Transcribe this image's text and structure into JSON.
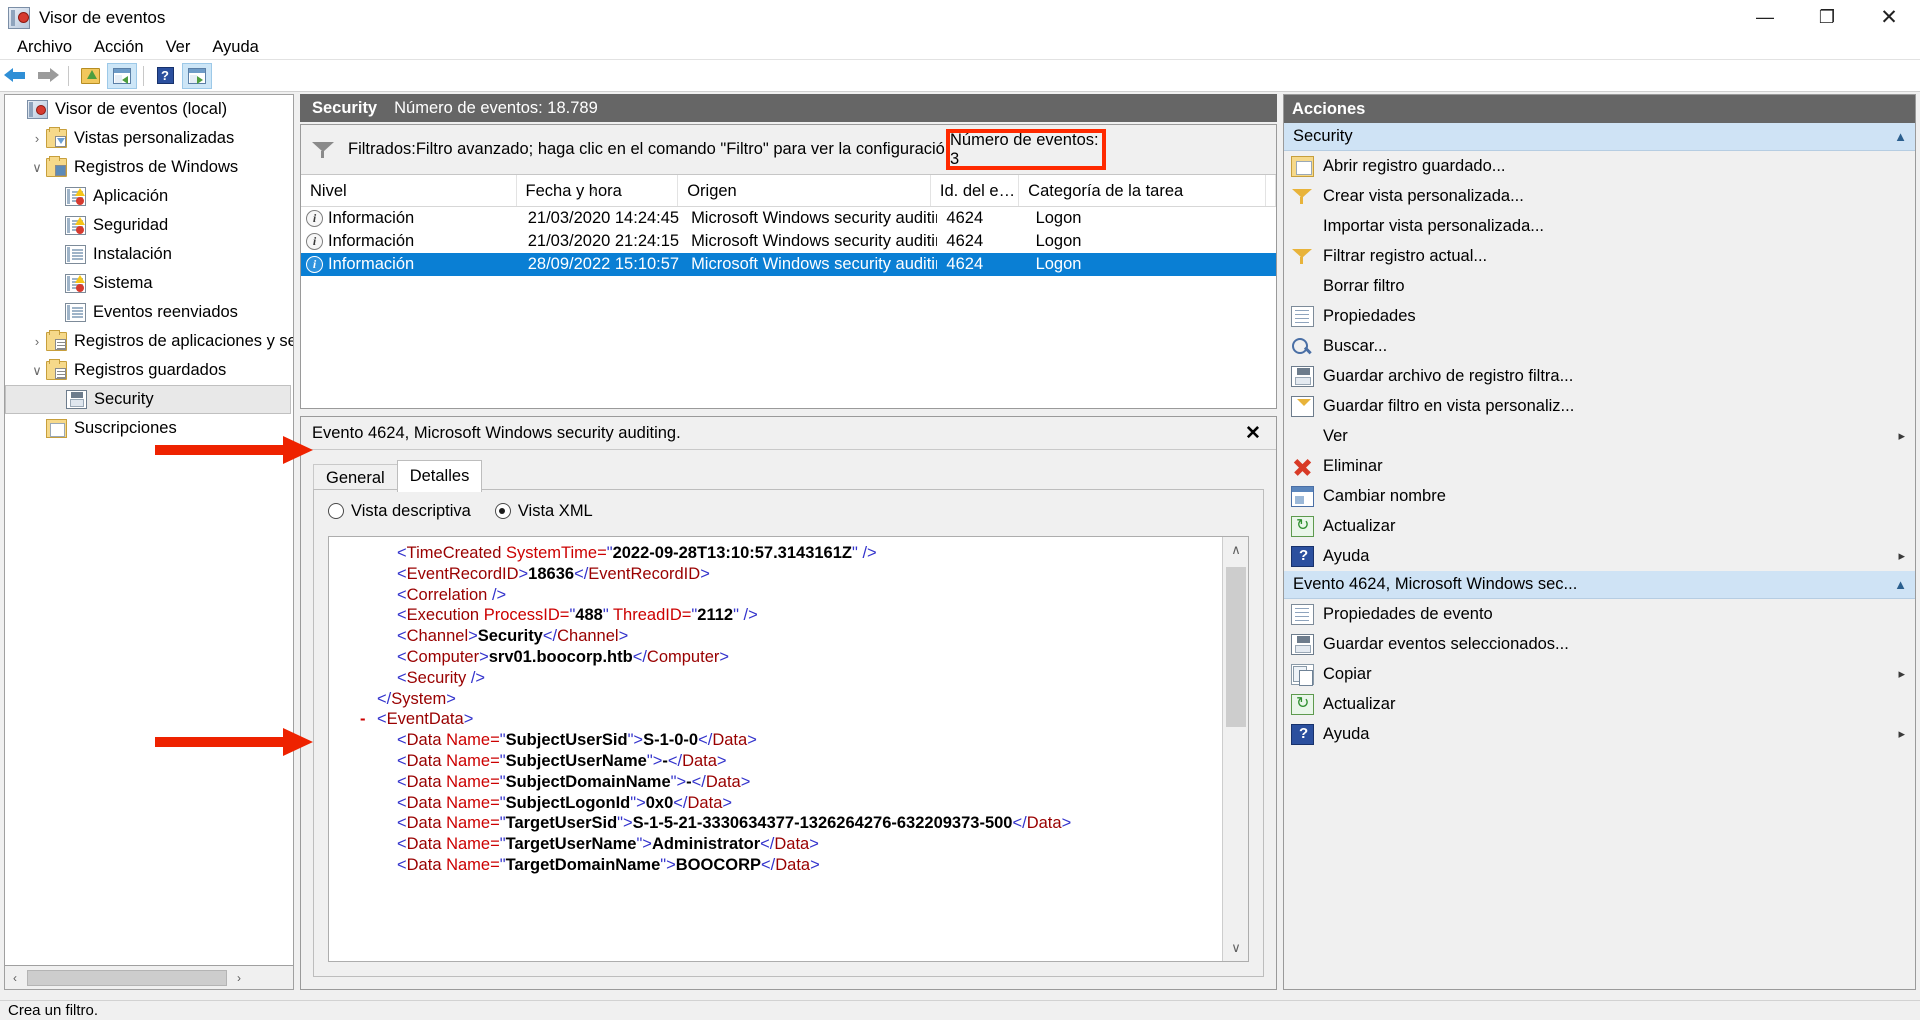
{
  "window": {
    "title": "Visor de eventos",
    "icon": "event-viewer-icon",
    "minimize": "—",
    "maximize": "❐",
    "close": "✕"
  },
  "menu": {
    "items": [
      "Archivo",
      "Acción",
      "Ver",
      "Ayuda"
    ]
  },
  "toolbar": {
    "back": "back-arrow-icon",
    "forward": "forward-arrow-icon",
    "open_folder": "open-folder-icon",
    "show_tree": "show-console-tree-icon",
    "help": "help-icon",
    "show_action_pane": "show-action-pane-icon"
  },
  "tree": {
    "items": [
      {
        "label": "Visor de eventos (local)",
        "indent": 0,
        "chevron": "",
        "icon": "event-viewer-icon"
      },
      {
        "label": "Vistas personalizadas",
        "indent": 1,
        "chevron": "›",
        "icon": "folder-filter-icon"
      },
      {
        "label": "Registros de Windows",
        "indent": 1,
        "chevron": "∨",
        "icon": "folder-windows-icon"
      },
      {
        "label": "Aplicación",
        "indent": 2,
        "chevron": "",
        "icon": "log-warning-icon"
      },
      {
        "label": "Seguridad",
        "indent": 2,
        "chevron": "",
        "icon": "log-warning-icon"
      },
      {
        "label": "Instalación",
        "indent": 2,
        "chevron": "",
        "icon": "log-icon"
      },
      {
        "label": "Sistema",
        "indent": 2,
        "chevron": "",
        "icon": "log-warning-icon"
      },
      {
        "label": "Eventos reenviados",
        "indent": 2,
        "chevron": "",
        "icon": "log-icon"
      },
      {
        "label": "Registros de aplicaciones y se",
        "indent": 1,
        "chevron": "›",
        "icon": "folder-apps-icon"
      },
      {
        "label": "Registros guardados",
        "indent": 1,
        "chevron": "∨",
        "icon": "folder-saved-icon"
      },
      {
        "label": "Security",
        "indent": 2,
        "chevron": "",
        "icon": "saved-log-icon",
        "selected": true
      },
      {
        "label": "Suscripciones",
        "indent": 1,
        "chevron": "",
        "icon": "subscriptions-icon"
      }
    ],
    "scroll_left": "‹",
    "scroll_right": "›"
  },
  "log_header": {
    "name": "Security",
    "count": "Número de eventos: 18.789"
  },
  "filter_bar": {
    "icon": "filter-funnel-icon",
    "text": "Filtrados:Filtro avanzado; haga clic en el comando \"Filtro\" para ver la configuración del filtro",
    "event_count": "Número de eventos: 3",
    "highlight_color": "#ff2a00"
  },
  "grid": {
    "columns": [
      "Nivel",
      "Fecha y hora",
      "Origen",
      "Id. del e…",
      "Categoría de la tarea"
    ],
    "sort_column_index": 1,
    "sort_mark": "˄",
    "rows": [
      {
        "level": "Información",
        "datetime": "21/03/2020 14:24:45",
        "source": "Microsoft Windows security auditing.",
        "event_id": "4624",
        "task": "Logon",
        "selected": false
      },
      {
        "level": "Información",
        "datetime": "21/03/2020 21:24:15",
        "source": "Microsoft Windows security auditing.",
        "event_id": "4624",
        "task": "Logon",
        "selected": false
      },
      {
        "level": "Información",
        "datetime": "28/09/2022 15:10:57",
        "source": "Microsoft Windows security auditing.",
        "event_id": "4624",
        "task": "Logon",
        "selected": true
      }
    ],
    "selection_color": "#0a7fd4"
  },
  "detail": {
    "title": "Evento 4624, Microsoft Windows security auditing.",
    "close": "✕",
    "tabs": [
      {
        "label": "General",
        "active": false
      },
      {
        "label": "Detalles",
        "active": true
      }
    ],
    "radios": [
      {
        "label": "Vista descriptiva",
        "selected": false
      },
      {
        "label": "Vista XML",
        "selected": true
      }
    ],
    "scroll_up": "∧",
    "scroll_down": "∨",
    "xml_lines": [
      {
        "indent": 1,
        "parts": [
          {
            "t": "br",
            "v": "<"
          },
          {
            "t": "tag",
            "v": "TimeCreated "
          },
          {
            "t": "attr",
            "v": "SystemTime"
          },
          {
            "t": "eq",
            "v": "="
          },
          {
            "t": "q",
            "v": "\""
          },
          {
            "t": "val",
            "v": "2022-09-28T13:10:57.3143161Z"
          },
          {
            "t": "q",
            "v": "\""
          },
          {
            "t": "br",
            "v": " />"
          }
        ]
      },
      {
        "indent": 1,
        "parts": [
          {
            "t": "br",
            "v": "<"
          },
          {
            "t": "tag",
            "v": "EventRecordID"
          },
          {
            "t": "br",
            "v": ">"
          },
          {
            "t": "val",
            "v": "18636"
          },
          {
            "t": "br",
            "v": "</"
          },
          {
            "t": "tag",
            "v": "EventRecordID"
          },
          {
            "t": "br",
            "v": ">"
          }
        ]
      },
      {
        "indent": 1,
        "parts": [
          {
            "t": "br",
            "v": "<"
          },
          {
            "t": "tag",
            "v": "Correlation "
          },
          {
            "t": "br",
            "v": "/>"
          }
        ]
      },
      {
        "indent": 1,
        "parts": [
          {
            "t": "br",
            "v": "<"
          },
          {
            "t": "tag",
            "v": "Execution "
          },
          {
            "t": "attr",
            "v": "ProcessID"
          },
          {
            "t": "eq",
            "v": "="
          },
          {
            "t": "q",
            "v": "\""
          },
          {
            "t": "val",
            "v": "488"
          },
          {
            "t": "q",
            "v": "\""
          },
          {
            "t": "attr",
            "v": " ThreadID"
          },
          {
            "t": "eq",
            "v": "="
          },
          {
            "t": "q",
            "v": "\""
          },
          {
            "t": "val",
            "v": "2112"
          },
          {
            "t": "q",
            "v": "\""
          },
          {
            "t": "br",
            "v": " />"
          }
        ]
      },
      {
        "indent": 1,
        "parts": [
          {
            "t": "br",
            "v": "<"
          },
          {
            "t": "tag",
            "v": "Channel"
          },
          {
            "t": "br",
            "v": ">"
          },
          {
            "t": "val",
            "v": "Security"
          },
          {
            "t": "br",
            "v": "</"
          },
          {
            "t": "tag",
            "v": "Channel"
          },
          {
            "t": "br",
            "v": ">"
          }
        ]
      },
      {
        "indent": 1,
        "parts": [
          {
            "t": "br",
            "v": "<"
          },
          {
            "t": "tag",
            "v": "Computer"
          },
          {
            "t": "br",
            "v": ">"
          },
          {
            "t": "val",
            "v": "srv01.boocorp.htb"
          },
          {
            "t": "br",
            "v": "</"
          },
          {
            "t": "tag",
            "v": "Computer"
          },
          {
            "t": "br",
            "v": ">"
          }
        ]
      },
      {
        "indent": 1,
        "parts": [
          {
            "t": "br",
            "v": "<"
          },
          {
            "t": "tag",
            "v": "Security "
          },
          {
            "t": "br",
            "v": "/>"
          }
        ]
      },
      {
        "indent": 0,
        "parts": [
          {
            "t": "br",
            "v": "</"
          },
          {
            "t": "tag",
            "v": "System"
          },
          {
            "t": "br",
            "v": ">"
          }
        ]
      },
      {
        "indent": 0,
        "minus": "-",
        "parts": [
          {
            "t": "br",
            "v": "<"
          },
          {
            "t": "tag",
            "v": "EventData"
          },
          {
            "t": "br",
            "v": ">"
          }
        ]
      },
      {
        "indent": 1,
        "parts": [
          {
            "t": "br",
            "v": "<"
          },
          {
            "t": "tag",
            "v": "Data "
          },
          {
            "t": "attr",
            "v": "Name"
          },
          {
            "t": "eq",
            "v": "="
          },
          {
            "t": "q",
            "v": "\""
          },
          {
            "t": "val",
            "v": "SubjectUserSid"
          },
          {
            "t": "q",
            "v": "\""
          },
          {
            "t": "br",
            "v": ">"
          },
          {
            "t": "val",
            "v": "S-1-0-0"
          },
          {
            "t": "br",
            "v": "</"
          },
          {
            "t": "tag",
            "v": "Data"
          },
          {
            "t": "br",
            "v": ">"
          }
        ]
      },
      {
        "indent": 1,
        "parts": [
          {
            "t": "br",
            "v": "<"
          },
          {
            "t": "tag",
            "v": "Data "
          },
          {
            "t": "attr",
            "v": "Name"
          },
          {
            "t": "eq",
            "v": "="
          },
          {
            "t": "q",
            "v": "\""
          },
          {
            "t": "val",
            "v": "SubjectUserName"
          },
          {
            "t": "q",
            "v": "\""
          },
          {
            "t": "br",
            "v": ">"
          },
          {
            "t": "val",
            "v": "-"
          },
          {
            "t": "br",
            "v": "</"
          },
          {
            "t": "tag",
            "v": "Data"
          },
          {
            "t": "br",
            "v": ">"
          }
        ]
      },
      {
        "indent": 1,
        "parts": [
          {
            "t": "br",
            "v": "<"
          },
          {
            "t": "tag",
            "v": "Data "
          },
          {
            "t": "attr",
            "v": "Name"
          },
          {
            "t": "eq",
            "v": "="
          },
          {
            "t": "q",
            "v": "\""
          },
          {
            "t": "val",
            "v": "SubjectDomainName"
          },
          {
            "t": "q",
            "v": "\""
          },
          {
            "t": "br",
            "v": ">"
          },
          {
            "t": "val",
            "v": "-"
          },
          {
            "t": "br",
            "v": "</"
          },
          {
            "t": "tag",
            "v": "Data"
          },
          {
            "t": "br",
            "v": ">"
          }
        ]
      },
      {
        "indent": 1,
        "parts": [
          {
            "t": "br",
            "v": "<"
          },
          {
            "t": "tag",
            "v": "Data "
          },
          {
            "t": "attr",
            "v": "Name"
          },
          {
            "t": "eq",
            "v": "="
          },
          {
            "t": "q",
            "v": "\""
          },
          {
            "t": "val",
            "v": "SubjectLogonId"
          },
          {
            "t": "q",
            "v": "\""
          },
          {
            "t": "br",
            "v": ">"
          },
          {
            "t": "val",
            "v": "0x0"
          },
          {
            "t": "br",
            "v": "</"
          },
          {
            "t": "tag",
            "v": "Data"
          },
          {
            "t": "br",
            "v": ">"
          }
        ]
      },
      {
        "indent": 1,
        "parts": [
          {
            "t": "br",
            "v": "<"
          },
          {
            "t": "tag",
            "v": "Data "
          },
          {
            "t": "attr",
            "v": "Name"
          },
          {
            "t": "eq",
            "v": "="
          },
          {
            "t": "q",
            "v": "\""
          },
          {
            "t": "val",
            "v": "TargetUserSid"
          },
          {
            "t": "q",
            "v": "\""
          },
          {
            "t": "br",
            "v": ">"
          },
          {
            "t": "val",
            "v": "S-1-5-21-3330634377-1326264276-632209373-500"
          },
          {
            "t": "br",
            "v": "</"
          },
          {
            "t": "tag",
            "v": "Data"
          },
          {
            "t": "br",
            "v": ">"
          }
        ]
      },
      {
        "indent": 1,
        "parts": [
          {
            "t": "br",
            "v": "<"
          },
          {
            "t": "tag",
            "v": "Data "
          },
          {
            "t": "attr",
            "v": "Name"
          },
          {
            "t": "eq",
            "v": "="
          },
          {
            "t": "q",
            "v": "\""
          },
          {
            "t": "val",
            "v": "TargetUserName"
          },
          {
            "t": "q",
            "v": "\""
          },
          {
            "t": "br",
            "v": ">"
          },
          {
            "t": "val",
            "v": "Administrator"
          },
          {
            "t": "br",
            "v": "</"
          },
          {
            "t": "tag",
            "v": "Data"
          },
          {
            "t": "br",
            "v": ">"
          }
        ]
      },
      {
        "indent": 1,
        "parts": [
          {
            "t": "br",
            "v": "<"
          },
          {
            "t": "tag",
            "v": "Data "
          },
          {
            "t": "attr",
            "v": "Name"
          },
          {
            "t": "eq",
            "v": "="
          },
          {
            "t": "q",
            "v": "\""
          },
          {
            "t": "val",
            "v": "TargetDomainName"
          },
          {
            "t": "q",
            "v": "\""
          },
          {
            "t": "br",
            "v": ">"
          },
          {
            "t": "val",
            "v": "BOOCORP"
          },
          {
            "t": "br",
            "v": "</"
          },
          {
            "t": "tag",
            "v": "Data"
          },
          {
            "t": "br",
            "v": ">"
          }
        ]
      }
    ]
  },
  "annotations": {
    "arrow_color": "#ee2200",
    "arrows": [
      {
        "name": "arrow-timecreated"
      },
      {
        "name": "arrow-targetusername"
      }
    ]
  },
  "actions": {
    "header": "Acciones",
    "groups": [
      {
        "title": "Security",
        "caret": "▲",
        "items": [
          {
            "label": "Abrir registro guardado...",
            "icon": "open-saved-log-icon",
            "submenu": ""
          },
          {
            "label": "Crear vista personalizada...",
            "icon": "create-custom-view-icon",
            "submenu": ""
          },
          {
            "label": "Importar vista personalizada...",
            "icon": "",
            "submenu": ""
          },
          {
            "label": "Filtrar registro actual...",
            "icon": "filter-current-log-icon",
            "submenu": ""
          },
          {
            "label": "Borrar filtro",
            "icon": "",
            "submenu": ""
          },
          {
            "label": "Propiedades",
            "icon": "properties-icon",
            "submenu": ""
          },
          {
            "label": "Buscar...",
            "icon": "find-icon",
            "submenu": ""
          },
          {
            "label": "Guardar archivo de registro filtra...",
            "icon": "save-log-icon",
            "submenu": ""
          },
          {
            "label": "Guardar filtro en vista personaliz...",
            "icon": "save-filter-icon",
            "submenu": ""
          },
          {
            "label": "Ver",
            "icon": "",
            "submenu": "▸"
          },
          {
            "label": "Eliminar",
            "icon": "delete-icon",
            "submenu": ""
          },
          {
            "label": "Cambiar nombre",
            "icon": "rename-icon",
            "submenu": ""
          },
          {
            "label": "Actualizar",
            "icon": "refresh-icon",
            "submenu": ""
          },
          {
            "label": "Ayuda",
            "icon": "help-icon",
            "submenu": "▸"
          }
        ]
      },
      {
        "title": "Evento 4624, Microsoft Windows sec...",
        "caret": "▲",
        "items": [
          {
            "label": "Propiedades de evento",
            "icon": "event-properties-icon",
            "submenu": ""
          },
          {
            "label": "Guardar eventos seleccionados...",
            "icon": "save-events-icon",
            "submenu": ""
          },
          {
            "label": "Copiar",
            "icon": "copy-icon",
            "submenu": "▸"
          },
          {
            "label": "Actualizar",
            "icon": "refresh-icon",
            "submenu": ""
          },
          {
            "label": "Ayuda",
            "icon": "help-icon",
            "submenu": "▸"
          }
        ]
      }
    ]
  },
  "statusbar": {
    "text": "Crea un filtro."
  }
}
